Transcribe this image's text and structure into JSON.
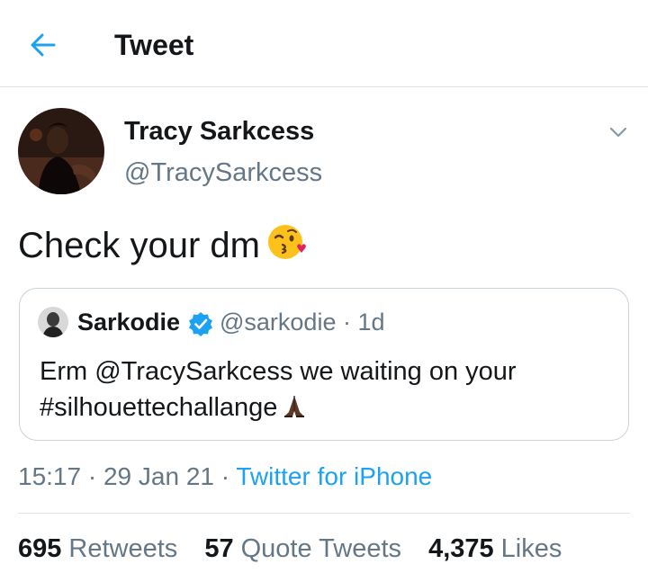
{
  "header": {
    "title": "Tweet",
    "back_icon": "arrow-left-icon"
  },
  "tweet": {
    "author_name": "Tracy Sarkcess",
    "author_handle": "@TracySarkcess",
    "text": "Check your dm",
    "text_emoji": "face-blowing-kiss-emoji",
    "menu_icon": "chevron-down-icon"
  },
  "quoted_tweet": {
    "author_name": "Sarkodie",
    "verified_icon": "verified-badge-icon",
    "author_handle": "@sarkodie",
    "separator": "·",
    "age": "1d",
    "text": "Erm @TracySarkcess we waiting on your #silhouettechallange",
    "text_emoji": "folded-hands-emoji"
  },
  "meta": {
    "time": "15:17",
    "date": "29 Jan 21",
    "separator": "·",
    "source": "Twitter for iPhone"
  },
  "stats": {
    "retweets_count": "695",
    "retweets_label": "Retweets",
    "quote_tweets_count": "57",
    "quote_tweets_label": "Quote Tweets",
    "likes_count": "4,375",
    "likes_label": "Likes"
  },
  "colors": {
    "accent": "#1da1f2",
    "secondary_text": "#657786",
    "primary_text": "#14171a",
    "border": "#dfe3e7"
  }
}
